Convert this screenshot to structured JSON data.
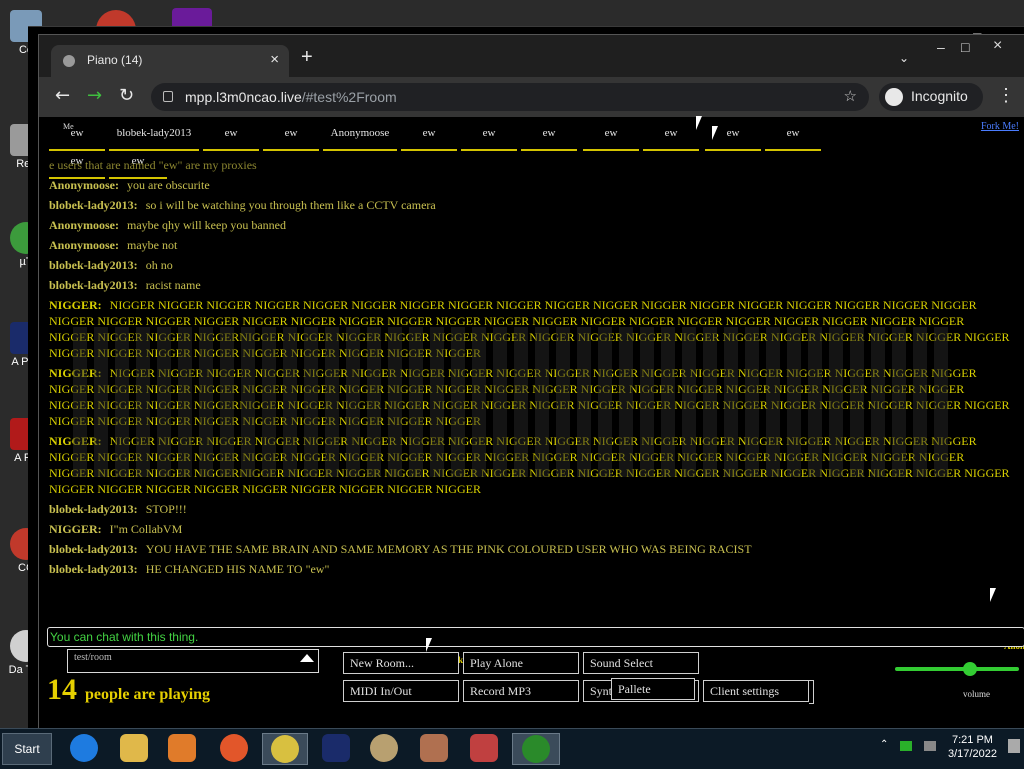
{
  "desktop": {
    "icons": [
      {
        "label": "Co"
      },
      {
        "label": "Rec"
      },
      {
        "label": "µT"
      },
      {
        "label": "A Pho"
      },
      {
        "label": "A Re"
      },
      {
        "label": "CC"
      },
      {
        "label": "Da Too"
      }
    ]
  },
  "browser": {
    "tab_title": "Piano (14)",
    "tab_close": "×",
    "new_tab": "+",
    "url_host": "mpp.l3m0ncao.live",
    "url_path": "/#test%2Froom",
    "incognito_label": "Incognito",
    "window_controls": [
      "–",
      "□",
      "×"
    ]
  },
  "page": {
    "fork_link": "Fork Me!",
    "user_boxes": [
      {
        "label": "ew",
        "tag": "Me"
      },
      {
        "label": "blobek-lady2013"
      },
      {
        "label": "ew"
      },
      {
        "label": "ew"
      },
      {
        "label": "Anonymoose"
      },
      {
        "label": "ew"
      },
      {
        "label": "ew"
      },
      {
        "label": "ew"
      },
      {
        "label": "ew"
      },
      {
        "label": "ew"
      },
      {
        "label": "ew"
      },
      {
        "label": "ew"
      },
      {
        "label": "ew"
      },
      {
        "label": "ew"
      }
    ],
    "chat_messages": [
      {
        "name": "",
        "text": "e users that are named \"ew\" are my proxies",
        "style": "faded"
      },
      {
        "name": "Anonymoose:",
        "text": "you are obscurite",
        "style": "normal"
      },
      {
        "name": "blobek-lady2013:",
        "text": "so i will be watching you through them like a CCTV camera",
        "style": "normal"
      },
      {
        "name": "Anonymoose:",
        "text": "maybe qhy will keep you banned",
        "style": "normal"
      },
      {
        "name": "Anonymoose:",
        "text": "maybe not",
        "style": "normal"
      },
      {
        "name": "blobek-lady2013:",
        "text": "oh no",
        "style": "normal"
      },
      {
        "name": "blobek-lady2013:",
        "text": "racist name",
        "style": "normal"
      },
      {
        "name": "NIGGER:",
        "text": "NIGGER NIGGER NIGGER NIGGER NIGGER NIGGER NIGGER NIGGER NIGGER NIGGER NIGGER NIGGER NIGGER NIGGER NIGGER NIGGER NIGGER NIGGER NIGGER NIGGER NIGGER NIGGER NIGGER NIGGER NIGGER NIGGER NIGGER NIGGER NIGGER NIGGER NIGGER NIGGER NIGGER NIGGER NIGGER NIGGER NIGGER NIGGER NIGGER NIGGER NIGGERNIGGER NIGGER NIGGER NIGGER NIGGER NIGGER NIGGER NIGGER NIGGER NIGGER NIGGER NIGGER NIGGER NIGGER NIGGER NIGGER NIGGER NIGGER NIGGER NIGGER NIGGER NIGGER NIGGER NIGGER NIGGER",
        "style": "big"
      },
      {
        "name": "NIGGER:",
        "text": "NIGGER NIGGER NIGGER NIGGER NIGGER NIGGER NIGGER NIGGER NIGGER NIGGER NIGGER NIGGER NIGGER NIGGER NIGGER NIGGER NIGGER NIGGER NIGGER NIGGER NIGGER NIGGER NIGGER NIGGER NIGGER NIGGER NIGGER NIGGER NIGGER NIGGER NIGGER NIGGER NIGGER NIGGER NIGGER NIGGER NIGGER NIGGER NIGGER NIGGER NIGGERNIGGER NIGGER NIGGER NIGGER NIGGER NIGGER NIGGER NIGGER NIGGER NIGGER NIGGER NIGGER NIGGER NIGGER NIGGER NIGGER NIGGER NIGGER NIGGER NIGGER NIGGER NIGGER NIGGER NIGGER NIGGER",
        "style": "big"
      },
      {
        "name": "NIGGER:",
        "text": "NIGGER NIGGER NIGGER NIGGER NIGGER NIGGER NIGGER NIGGER NIGGER NIGGER NIGGER NIGGER NIGGER NIGGER NIGGER NIGGER NIGGER NIGGER NIGGER NIGGER NIGGER NIGGER NIGGER NIGGER NIGGER NIGGER NIGGER NIGGER NIGGER NIGGER NIGGER NIGGER NIGGER NIGGER NIGGER NIGGER NIGGER NIGGER NIGGER NIGGER NIGGERNIGGER NIGGER NIGGER NIGGER NIGGER NIGGER NIGGER NIGGER NIGGER NIGGER NIGGER NIGGER NIGGER NIGGER NIGGER NIGGER NIGGER NIGGER NIGGER NIGGER NIGGER NIGGER NIGGER NIGGER NIGGER",
        "style": "big"
      },
      {
        "name": "blobek-lady2013:",
        "text": "STOP!!!",
        "style": "normal"
      },
      {
        "name": "NIGGER:",
        "text": "I\"m CollabVM",
        "style": "normal"
      },
      {
        "name": "blobek-lady2013:",
        "text": "YOU HAVE THE SAME BRAIN AND SAME MEMORY AS THE PINK COLOURED USER WHO WAS BEING RACIST",
        "style": "normal"
      },
      {
        "name": "blobek-lady2013:",
        "text": "HE CHANGED HIS NAME TO \"ew\"",
        "style": "normal"
      }
    ],
    "chat_input_placeholder": "You can chat with this thing.",
    "room_select_value": "test/room",
    "playing_count": "14",
    "playing_text": "people are playing",
    "room_owner_tag": "blobek-lady2013",
    "buttons": {
      "new_room": "New Room...",
      "play_alone": "Play Alone",
      "sound_select": "Sound Select",
      "midi": "MIDI In/Out",
      "record_mp3": "Record MP3",
      "synth": "Synth",
      "pallete": "Pallete",
      "client_settings": "Client settings"
    },
    "volume_label": "volume",
    "side_name": "Anon"
  },
  "taskbar": {
    "start_label": "Start",
    "apps": [
      "internet-explorer-icon",
      "folder-icon",
      "media-player-icon",
      "firefox-icon",
      "chrome-icon",
      "photoshop-icon",
      "paint-icon",
      "paint-brush-icon",
      "tools-icon",
      "talk-icon"
    ],
    "tray_time": "7:21 PM",
    "tray_date": "3/17/2022"
  }
}
